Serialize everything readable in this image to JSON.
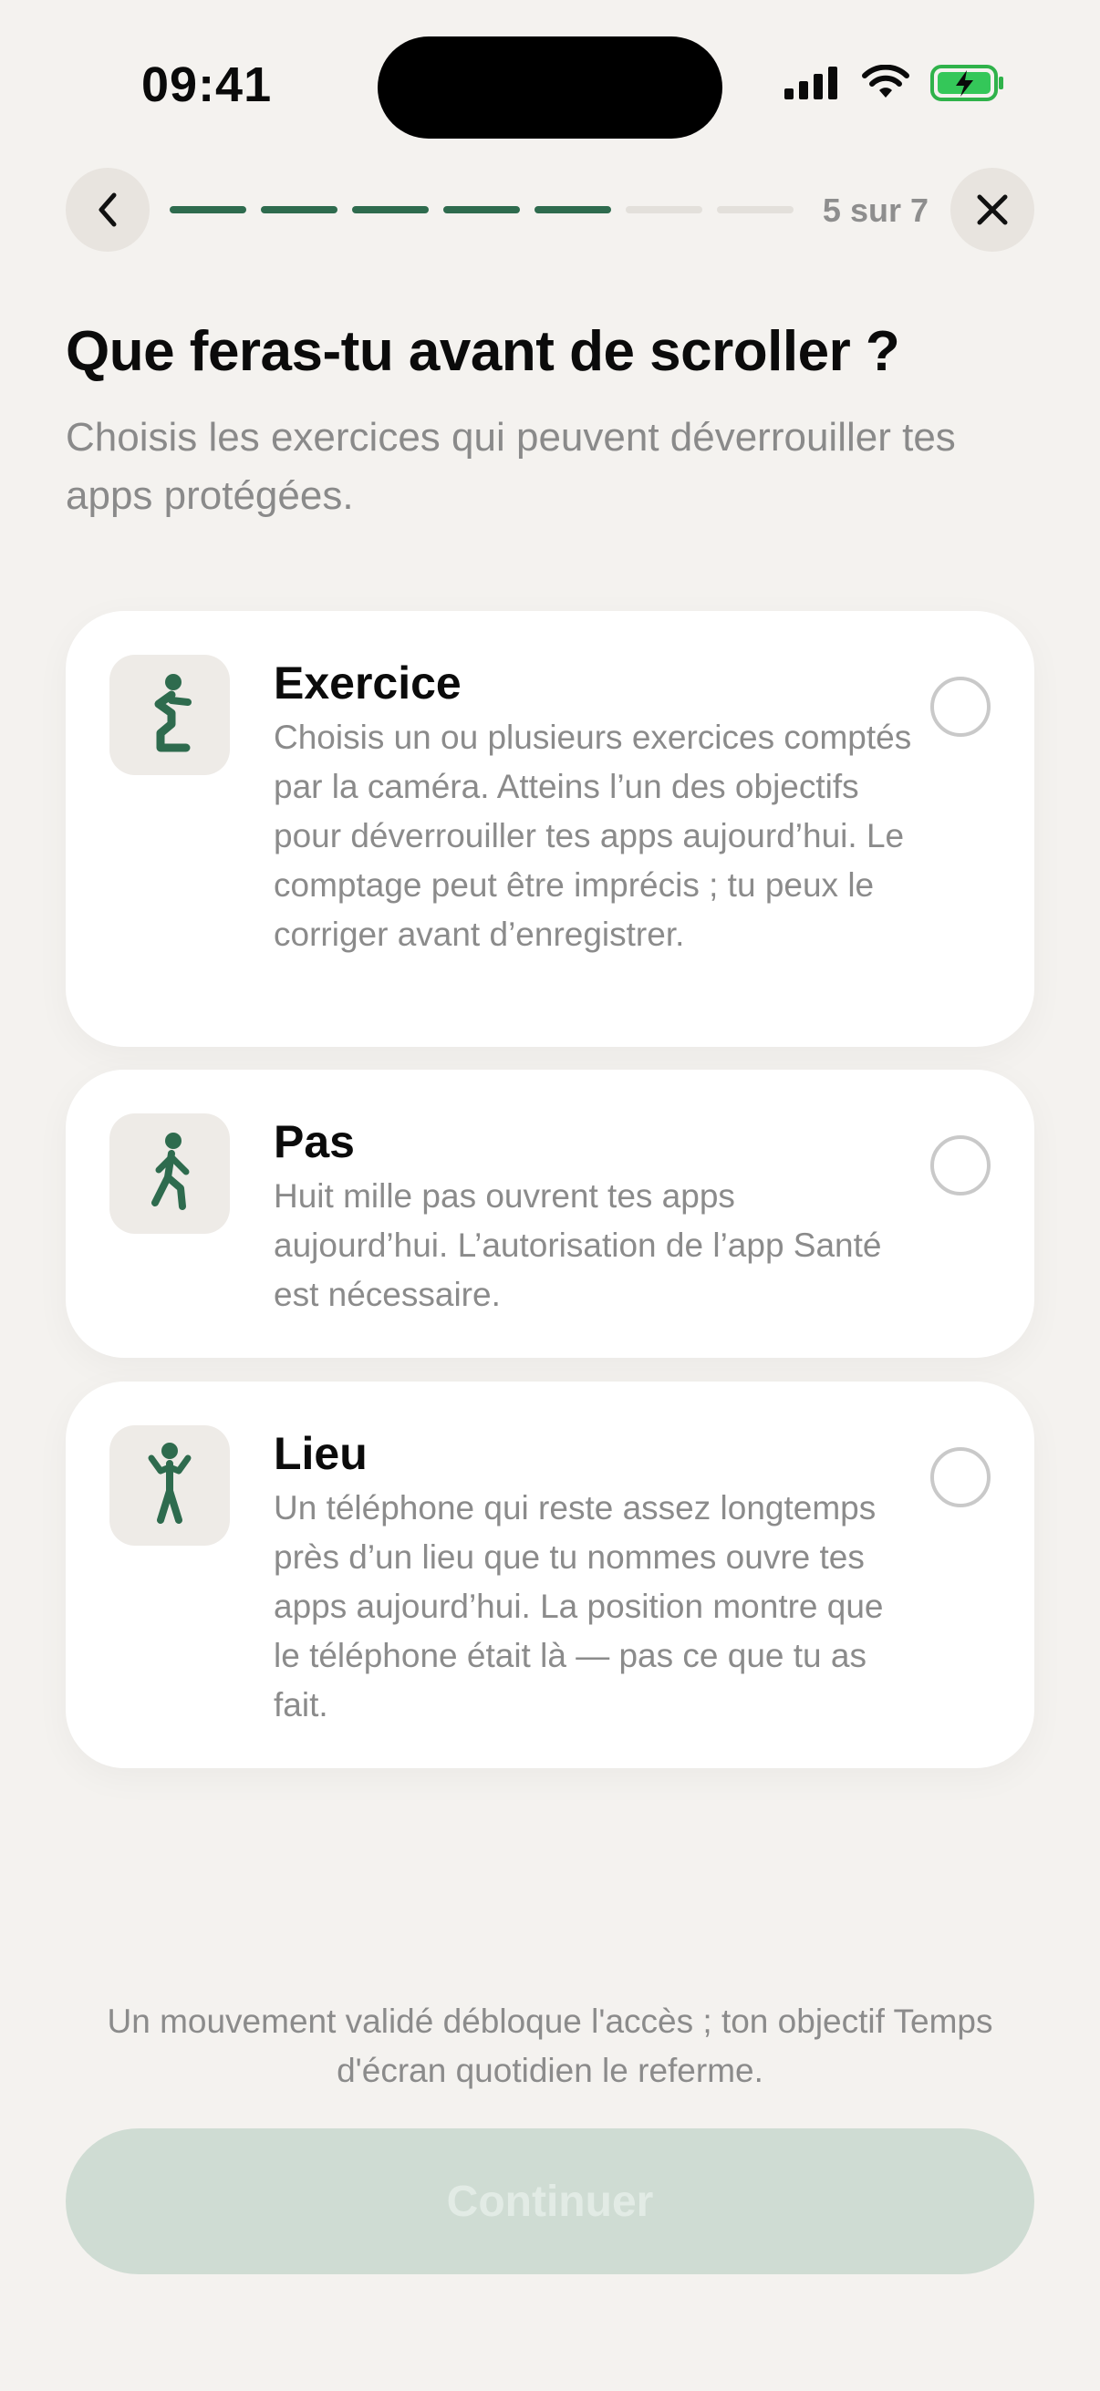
{
  "status_bar": {
    "time": "09:41"
  },
  "nav": {
    "step_label": "5 sur 7",
    "progress_total": 7,
    "progress_completed": 5
  },
  "header": {
    "title": "Que feras-tu avant de scroller ?",
    "subtitle": "Choisis les exercices qui peuvent déverrouiller tes apps protégées."
  },
  "options": [
    {
      "title": "Exercice",
      "description": "Choisis un ou plusieurs exercices comptés par la caméra. Atteins l’un des objectifs pour déverrouiller tes apps aujourd’hui. Le comptage peut être imprécis ; tu peux le corriger avant d’enregistrer.",
      "icon": "squat-figure-icon",
      "selected": false
    },
    {
      "title": "Pas",
      "description": "Huit mille pas ouvrent tes apps aujourd’hui. L’autorisation de l’app Santé est nécessaire.",
      "icon": "walking-figure-icon",
      "selected": false
    },
    {
      "title": "Lieu",
      "description": "Un téléphone qui reste assez longtemps près d’un lieu que tu nommes ouvre tes apps aujourd’hui. La position montre que le téléphone était là — pas ce que tu as fait.",
      "icon": "standing-figure-icon",
      "selected": false
    }
  ],
  "footer": {
    "note": "Un mouvement validé débloque l'accès ; ton objectif Temps d'écran quotidien le referme.",
    "continue_label": "Continuer"
  },
  "colors": {
    "background": "#f4f2ef",
    "accent": "#2e6b4e",
    "button_disabled": "#cfdcd3"
  }
}
